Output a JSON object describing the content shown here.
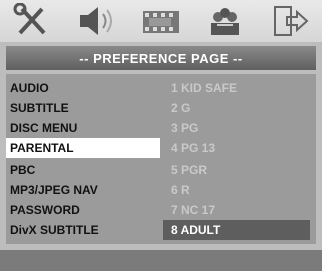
{
  "toolbar": {
    "icons": [
      "tools-icon",
      "speaker-icon",
      "film-icon",
      "preference-icon",
      "exit-icon"
    ]
  },
  "header": {
    "title": "-- PREFERENCE PAGE --"
  },
  "menu": {
    "items": [
      {
        "label": "AUDIO"
      },
      {
        "label": "SUBTITLE"
      },
      {
        "label": "DISC MENU"
      },
      {
        "label": "PARENTAL",
        "selected": true
      },
      {
        "label": "PBC"
      },
      {
        "label": "MP3/JPEG NAV"
      },
      {
        "label": "PASSWORD"
      },
      {
        "label": "DivX SUBTITLE"
      }
    ]
  },
  "options": {
    "items": [
      {
        "label": "1 KID SAFE"
      },
      {
        "label": "2 G"
      },
      {
        "label": "3 PG"
      },
      {
        "label": "4 PG 13"
      },
      {
        "label": "5 PGR"
      },
      {
        "label": "6 R"
      },
      {
        "label": "7 NC 17"
      },
      {
        "label": "8 ADULT",
        "selected": true
      }
    ]
  },
  "colors": {
    "background": "#bdbdbd",
    "panel": "#9b9b9b",
    "highlight": "#ffffff",
    "option_highlight": "#5e5e5e",
    "option_text": "#c9c9c9"
  }
}
